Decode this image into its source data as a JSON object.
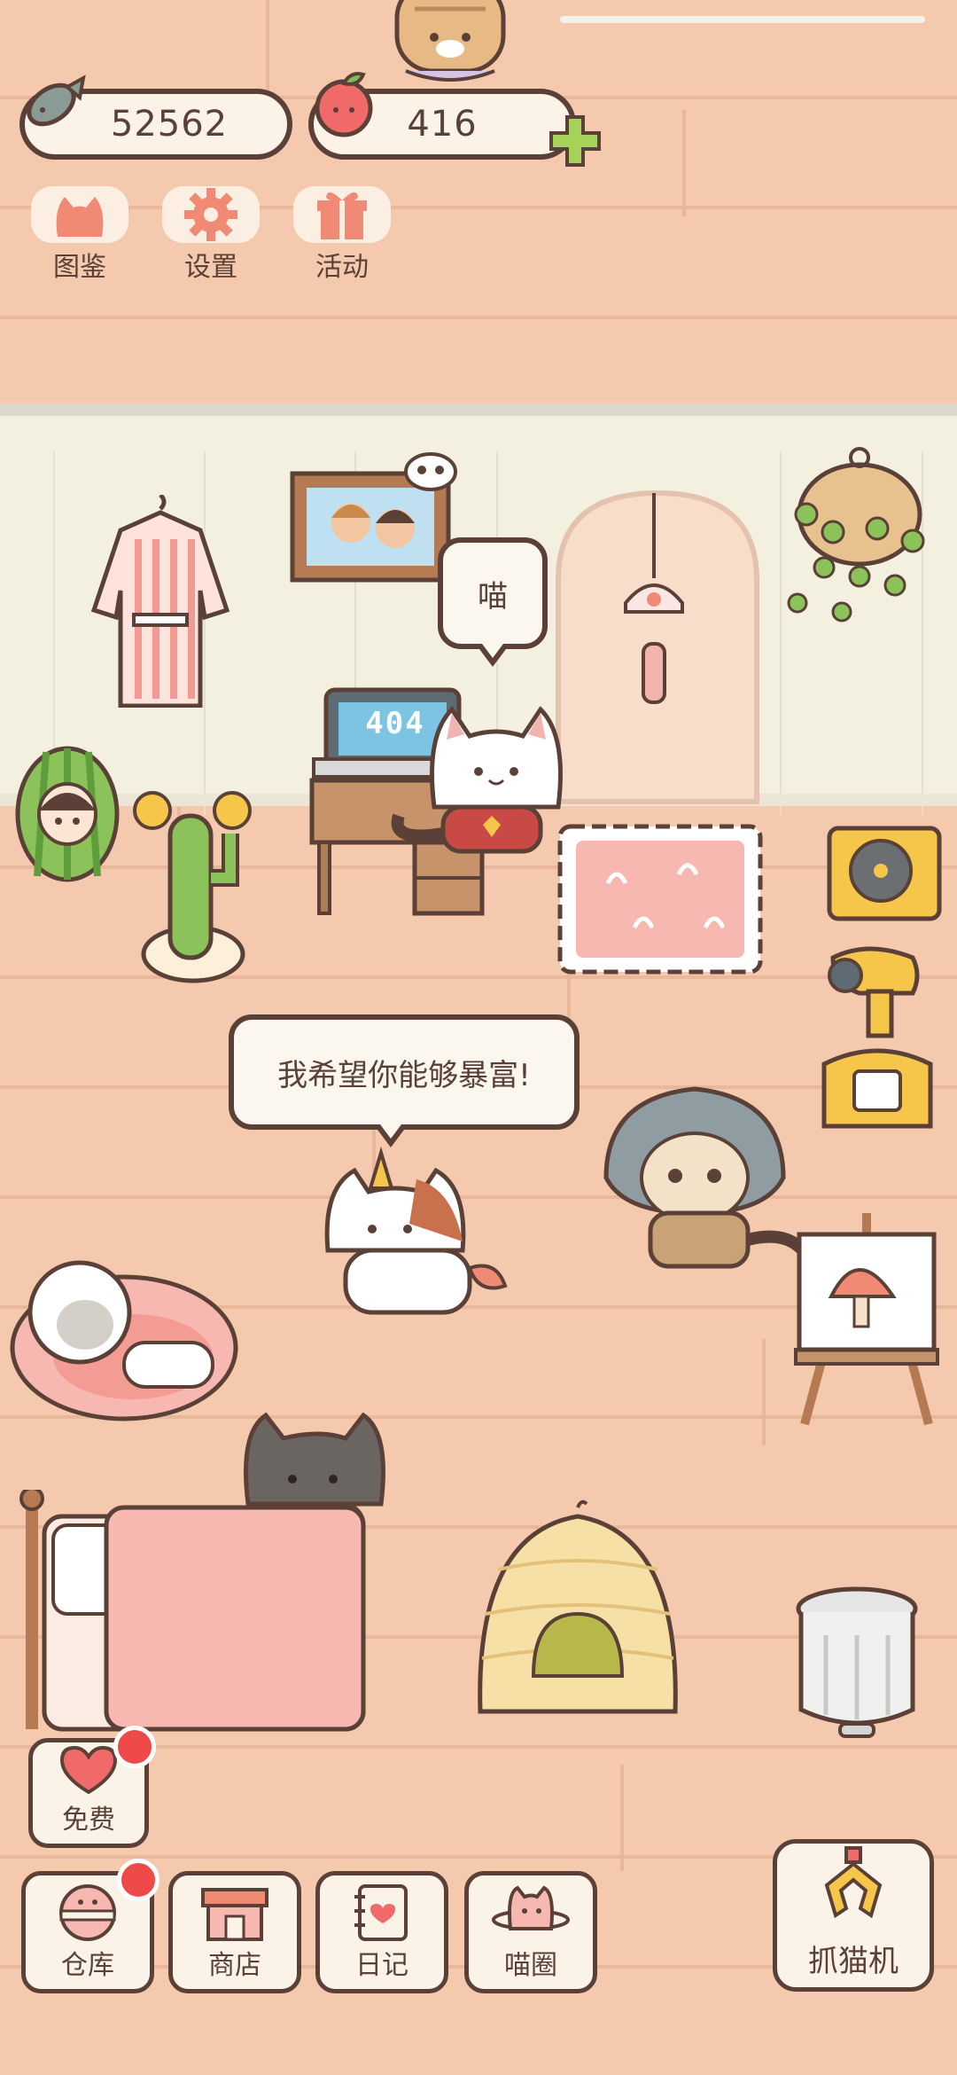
{
  "currency": {
    "fish_value": "52562",
    "apple_value": "416"
  },
  "hud": {
    "catalog_label": "图鉴",
    "settings_label": "设置",
    "events_label": "活动"
  },
  "speech": {
    "cat_meow": "喵",
    "cat_wish": "我希望你能够暴富!"
  },
  "monitor_text": "404",
  "bottom": {
    "free_label": "免费",
    "warehouse_label": "仓库",
    "shop_label": "商店",
    "diary_label": "日记",
    "circle_label": "喵圈",
    "claw_label": "抓猫机"
  },
  "colors": {
    "outline": "#5a4036",
    "floor": "#f4c9ad",
    "badge": "#ef4a4a",
    "accent_pink": "#f08a74",
    "plus_green": "#a6d25a"
  }
}
